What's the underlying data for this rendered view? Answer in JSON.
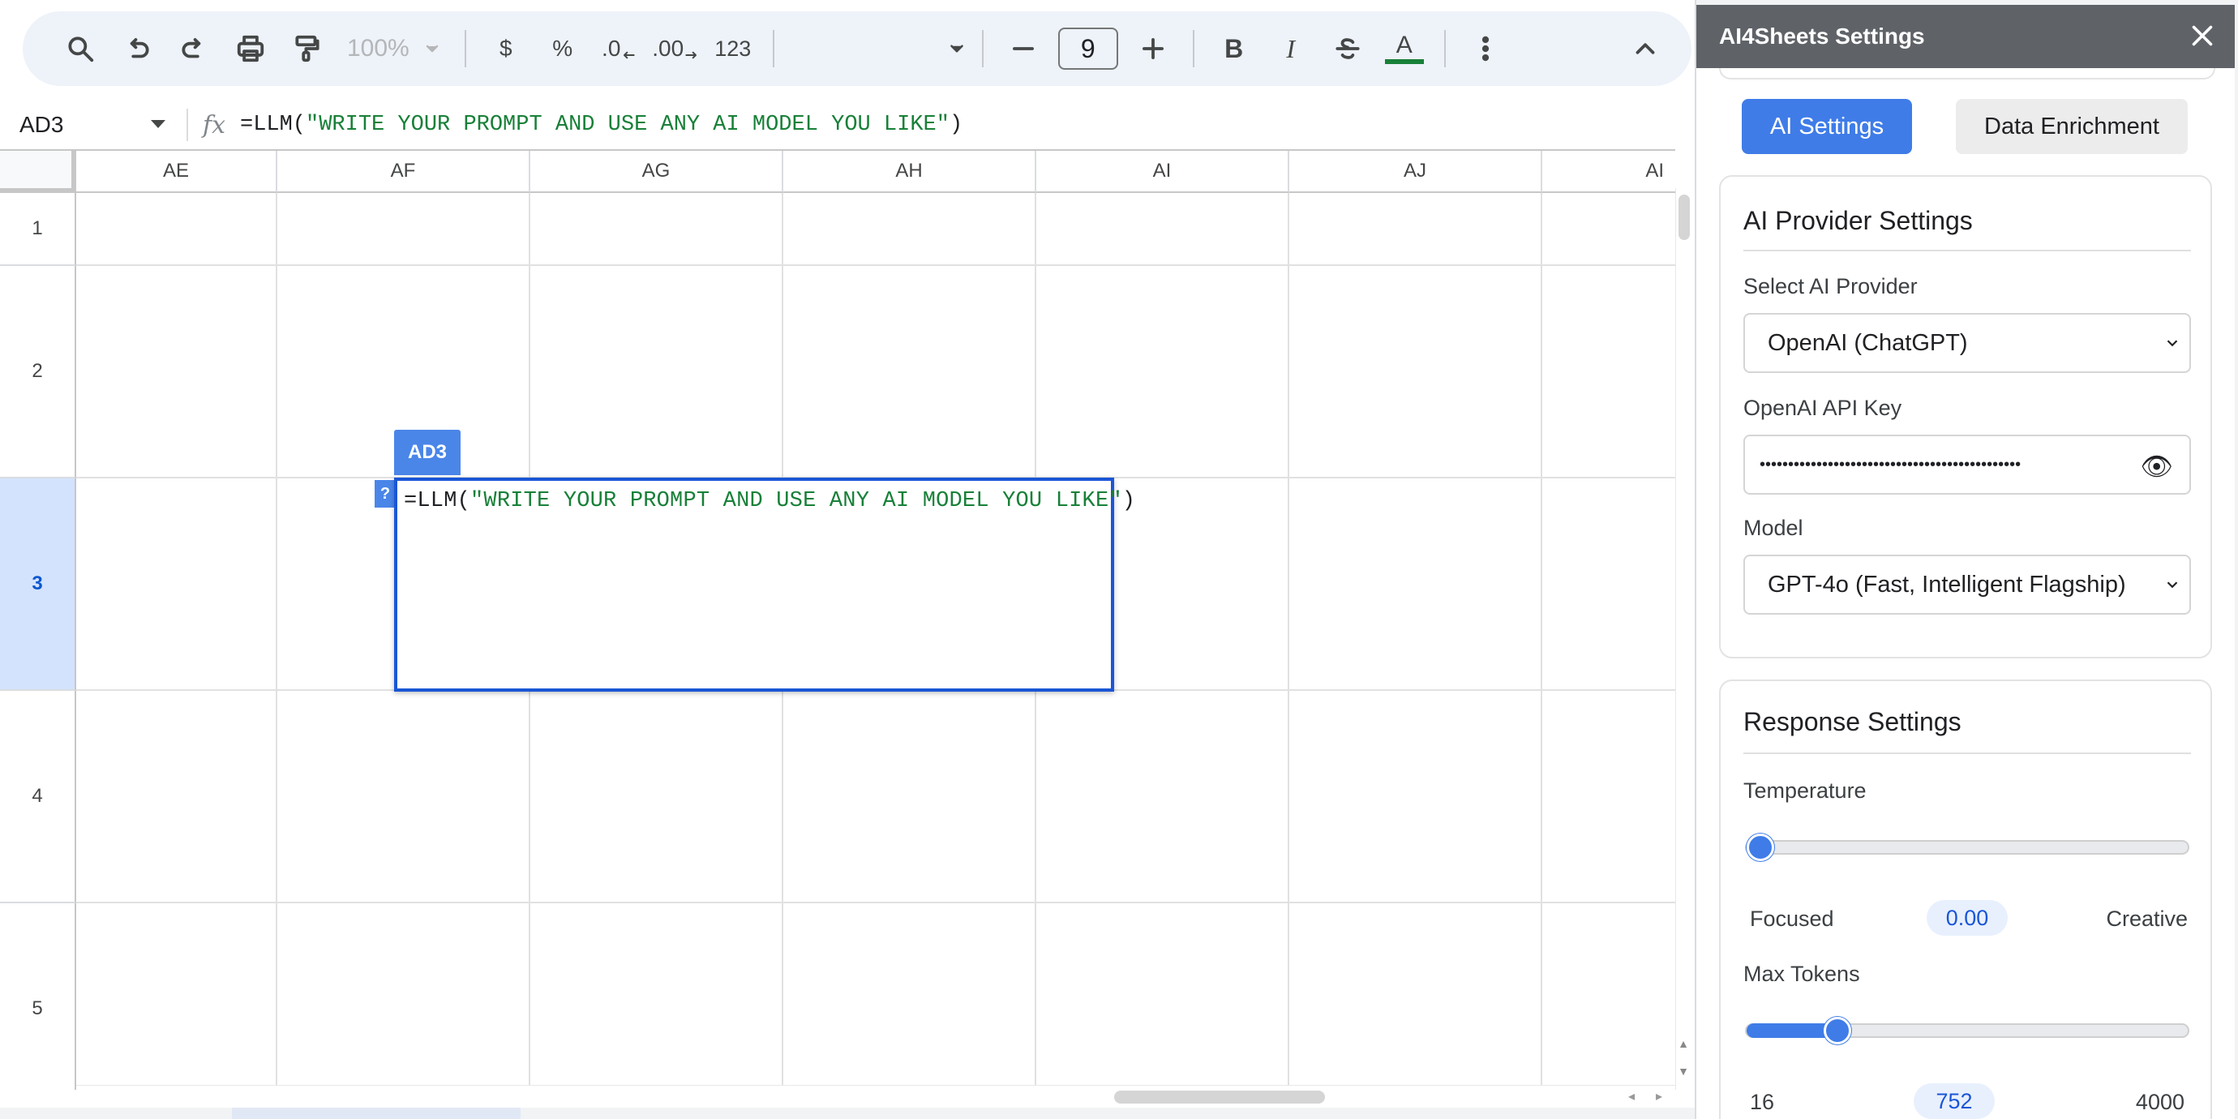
{
  "toolbar": {
    "zoom": "100%",
    "currency": "$",
    "percent": "%",
    "decrease_decimal": ".0",
    "increase_decimal": ".00",
    "number_format": "123",
    "font_size": "9",
    "bold": "B",
    "italic": "I",
    "text_color_letter": "A",
    "text_color": "#188038"
  },
  "formula_bar": {
    "cell_ref": "AD3",
    "fx": "fx",
    "formula_prefix": "=LLM(",
    "formula_string": "\"WRITE YOUR PROMPT AND USE ANY AI MODEL YOU LIKE\"",
    "formula_suffix": ")"
  },
  "grid": {
    "columns": [
      "AE",
      "AF",
      "AG",
      "AH",
      "AI",
      "AJ",
      "AI"
    ],
    "rows": [
      "1",
      "2",
      "3",
      "4",
      "5"
    ],
    "selected_row": "3"
  },
  "editor": {
    "tag": "AD3",
    "help": "?",
    "formula_prefix": "=LLM(",
    "formula_string": "\"WRITE YOUR PROMPT AND USE ANY AI MODEL YOU LIKE\"",
    "formula_suffix": ")"
  },
  "panel": {
    "title": "AI4Sheets Settings",
    "tabs": {
      "ai_settings": "AI Settings",
      "data_enrichment": "Data Enrichment"
    },
    "provider_card": {
      "title": "AI Provider Settings",
      "provider_label": "Select AI Provider",
      "provider_value": "OpenAI (ChatGPT)",
      "api_key_label": "OpenAI API Key",
      "api_key_value": "••••••••••••••••••••••••••••••••••••••••••••••",
      "model_label": "Model",
      "model_value": "GPT-4o (Fast, Intelligent Flagship)"
    },
    "response_card": {
      "title": "Response Settings",
      "temperature_label": "Temperature",
      "temperature_min_label": "Focused",
      "temperature_value": "0.00",
      "temperature_max_label": "Creative",
      "temperature_fraction": 0.0,
      "max_tokens_label": "Max Tokens",
      "max_tokens_min": "16",
      "max_tokens_value": "752",
      "max_tokens_max": "4000",
      "max_tokens_number": 752,
      "max_tokens_range": [
        16,
        4000
      ]
    }
  },
  "colors": {
    "accent": "#3f7ce8",
    "selection": "#1a56d6",
    "formula_string": "#188038",
    "panel_header": "#5f6368"
  }
}
